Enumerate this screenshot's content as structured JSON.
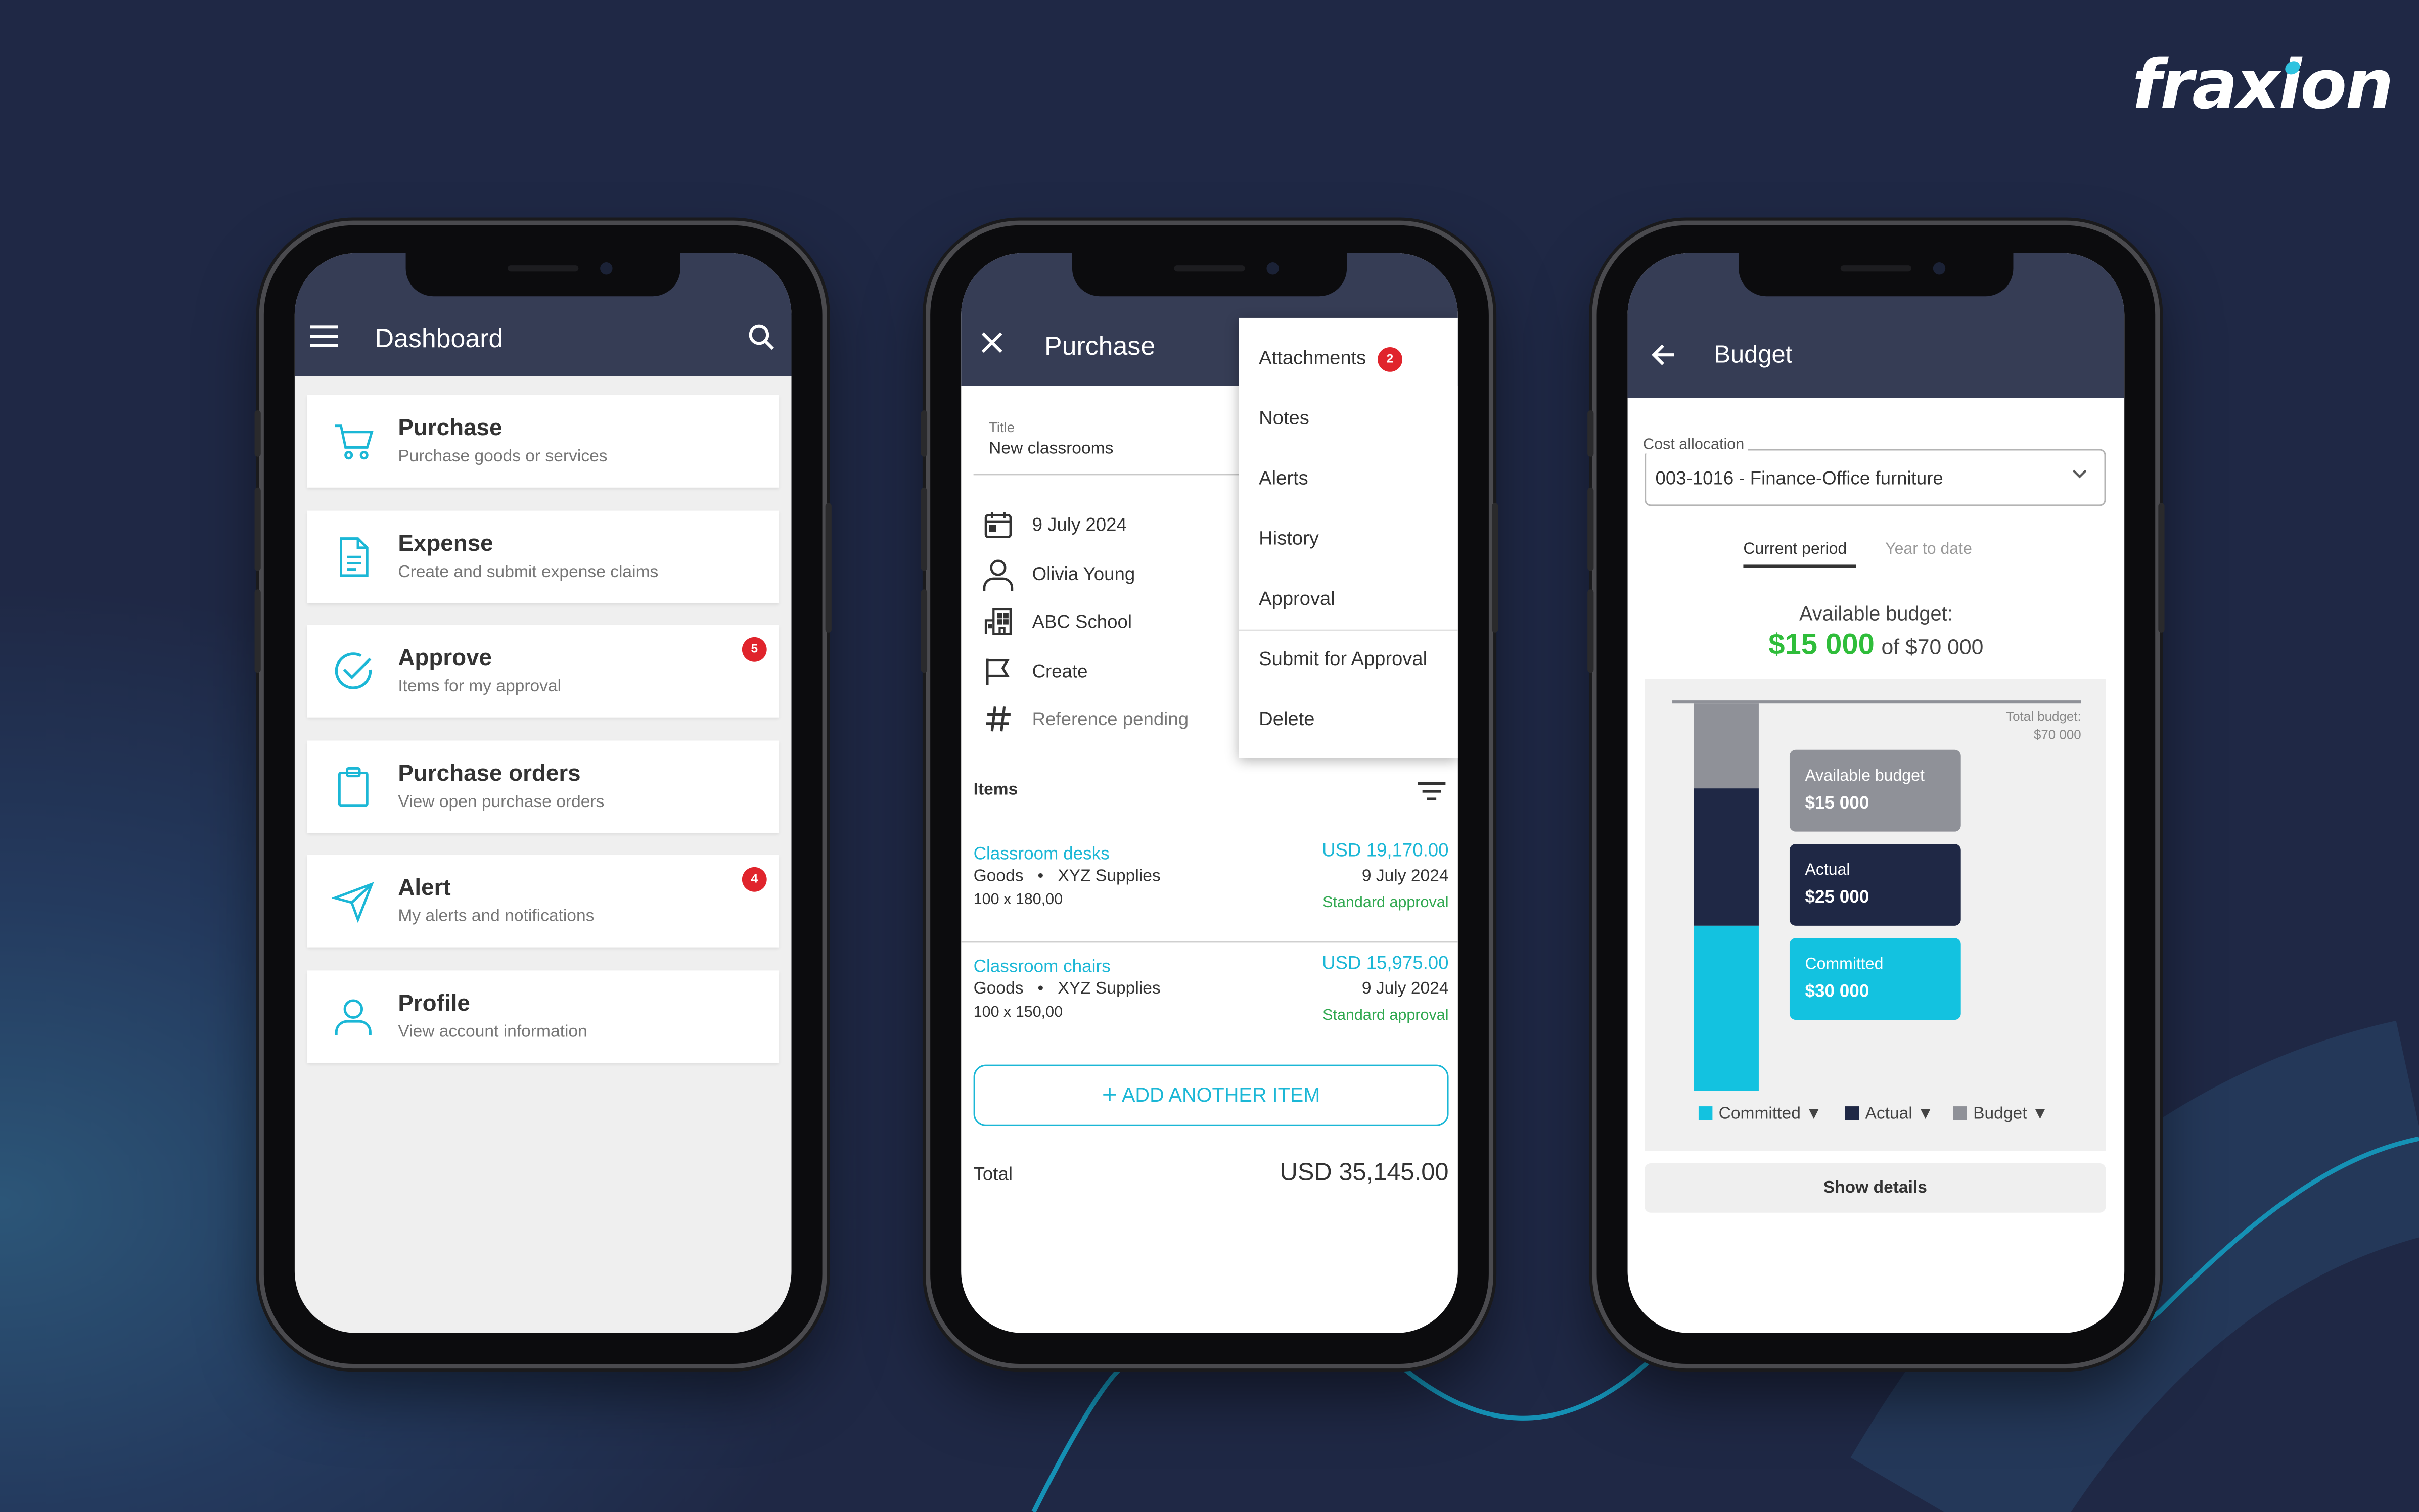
{
  "brand": {
    "logo_text": "fraxion",
    "accent_color": "#1bb7d6",
    "header_color": "#363d55",
    "background_color": "#1f2845"
  },
  "dashboard": {
    "title": "Dashboard",
    "cards": [
      {
        "title": "Purchase",
        "subtitle": "Purchase goods or services",
        "icon": "cart-icon"
      },
      {
        "title": "Expense",
        "subtitle": "Create and submit expense claims",
        "icon": "document-icon"
      },
      {
        "title": "Approve",
        "subtitle": "Items for my approval",
        "icon": "check-circle-icon",
        "badge": "5"
      },
      {
        "title": "Purchase orders",
        "subtitle": "View open purchase orders",
        "icon": "clipboard-icon"
      },
      {
        "title": "Alert",
        "subtitle": "My alerts and notifications",
        "icon": "send-icon",
        "badge": "4"
      },
      {
        "title": "Profile",
        "subtitle": "View account information",
        "icon": "user-icon"
      }
    ]
  },
  "purchase": {
    "title": "Purchase",
    "title_field": {
      "label": "Title",
      "value": "New classrooms"
    },
    "info": {
      "date": "9 July 2024",
      "requester": "Olivia Young",
      "organization": "ABC School",
      "status": "Create",
      "reference": "Reference pending"
    },
    "items_label": "Items",
    "items": [
      {
        "name": "Classroom desks",
        "category": "Goods",
        "supplier": "XYZ Supplies",
        "dimensions": "100 x 180,00",
        "amount": "USD 19,170.00",
        "date": "9 July 2024",
        "approval": "Standard approval"
      },
      {
        "name": "Classroom chairs",
        "category": "Goods",
        "supplier": "XYZ Supplies",
        "dimensions": "100 x 150,00",
        "amount": "USD 15,975.00",
        "date": "9 July 2024",
        "approval": "Standard approval"
      }
    ],
    "add_item_label": "ADD ANOTHER ITEM",
    "total_label": "Total",
    "total_value": "USD 35,145.00",
    "menu": {
      "attachments": "Attachments",
      "attachments_badge": "2",
      "notes": "Notes",
      "alerts": "Alerts",
      "history": "History",
      "approval": "Approval",
      "submit": "Submit for Approval",
      "delete": "Delete"
    }
  },
  "budget": {
    "title": "Budget",
    "cost_allocation_label": "Cost allocation",
    "cost_allocation_value": "003-1016 - Finance-Office furniture",
    "tabs": {
      "current": "Current period",
      "ytd": "Year to date"
    },
    "available_label": "Available budget:",
    "available_amount": "$15 000",
    "available_of": "of $70 000",
    "total_budget_label": "Total budget:",
    "total_budget_value": "$70 000",
    "cards": [
      {
        "label": "Available budget",
        "value": "$15 000",
        "color": "#8f9198"
      },
      {
        "label": "Actual",
        "value": "$25 000",
        "color": "#1f2845"
      },
      {
        "label": "Committed",
        "value": "$30 000",
        "color": "#13c2e0"
      }
    ],
    "legend": [
      {
        "label": "Committed ▼",
        "color": "#13c2e0"
      },
      {
        "label": "Actual ▼",
        "color": "#1f2845"
      },
      {
        "label": "Budget ▼",
        "color": "#8f9198"
      }
    ],
    "show_details_label": "Show details"
  }
}
